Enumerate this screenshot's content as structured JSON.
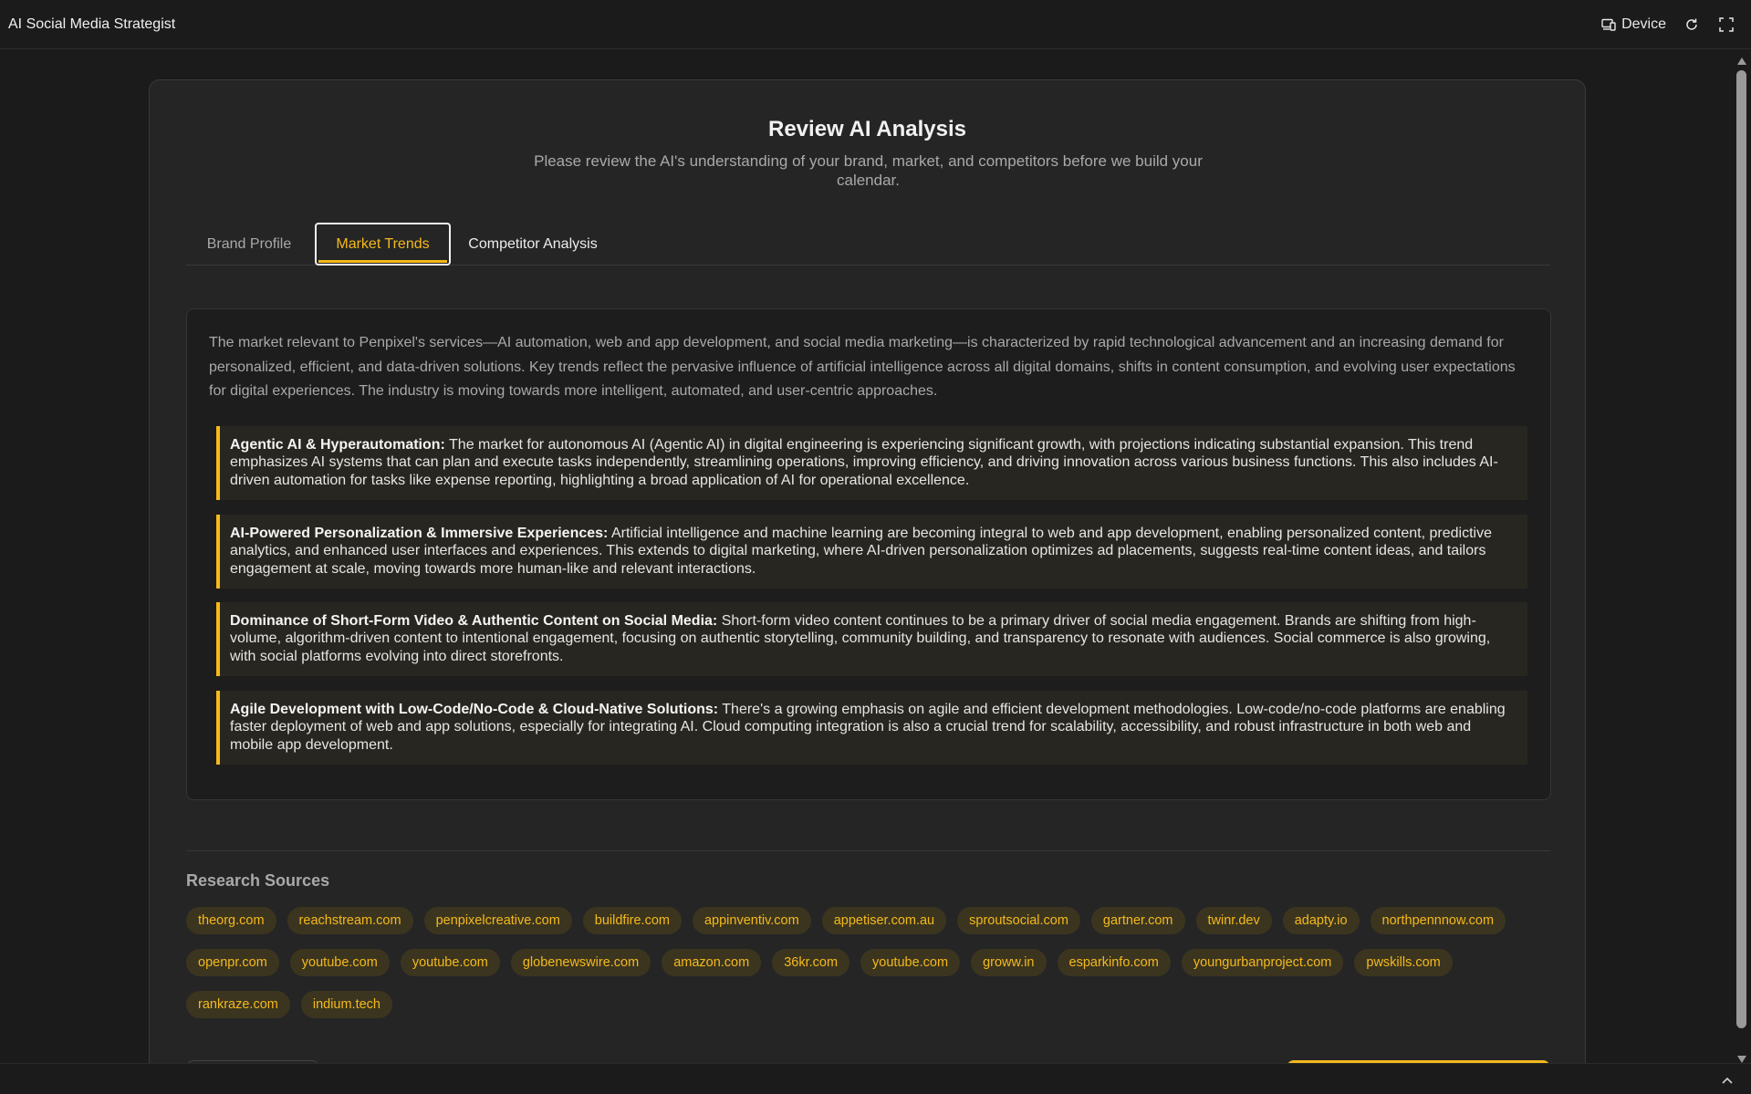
{
  "app": {
    "title": "AI Social Media Strategist",
    "device_label": "Device"
  },
  "header": {
    "title": "Review AI Analysis",
    "subtitle": "Please review the AI's understanding of your brand, market, and competitors before we build your calendar."
  },
  "tabs": [
    {
      "label": "Brand Profile",
      "active": false
    },
    {
      "label": "Market Trends",
      "active": true
    },
    {
      "label": "Competitor Analysis",
      "active": false
    }
  ],
  "market": {
    "intro": "The market relevant to Penpixel's services—AI automation, web and app development, and social media marketing—is characterized by rapid technological advancement and an increasing demand for personalized, efficient, and data-driven solutions. Key trends reflect the pervasive influence of artificial intelligence across all digital domains, shifts in content consumption, and evolving user expectations for digital experiences. The industry is moving towards more intelligent, automated, and user-centric approaches.",
    "trends": [
      {
        "title": "Agentic AI & Hyperautomation:",
        "text": " The market for autonomous AI (Agentic AI) in digital engineering is experiencing significant growth, with projections indicating substantial expansion. This trend emphasizes AI systems that can plan and execute tasks independently, streamlining operations, improving efficiency, and driving innovation across various business functions. This also includes AI-driven automation for tasks like expense reporting, highlighting a broad application of AI for operational excellence."
      },
      {
        "title": "AI-Powered Personalization & Immersive Experiences:",
        "text": " Artificial intelligence and machine learning are becoming integral to web and app development, enabling personalized content, predictive analytics, and enhanced user interfaces and experiences. This extends to digital marketing, where AI-driven personalization optimizes ad placements, suggests real-time content ideas, and tailors engagement at scale, moving towards more human-like and relevant interactions."
      },
      {
        "title": "Dominance of Short-Form Video & Authentic Content on Social Media:",
        "text": " Short-form video content continues to be a primary driver of social media engagement. Brands are shifting from high-volume, algorithm-driven content to intentional engagement, focusing on authentic storytelling, community building, and transparency to resonate with audiences. Social commerce is also growing, with social platforms evolving into direct storefronts."
      },
      {
        "title": "Agile Development with Low-Code/No-Code & Cloud-Native Solutions:",
        "text": " There's a growing emphasis on agile and efficient development methodologies. Low-code/no-code platforms are enabling faster deployment of web and app solutions, especially for integrating AI. Cloud computing integration is also a crucial trend for scalability, accessibility, and robust infrastructure in both web and mobile app development."
      }
    ]
  },
  "sources": {
    "title": "Research Sources",
    "items": [
      "theorg.com",
      "reachstream.com",
      "penpixelcreative.com",
      "buildfire.com",
      "appinventiv.com",
      "appetiser.com.au",
      "sproutsocial.com",
      "gartner.com",
      "twinr.dev",
      "adapty.io",
      "northpennnow.com",
      "openpr.com",
      "youtube.com",
      "youtube.com",
      "globenewswire.com",
      "amazon.com",
      "36kr.com",
      "youtube.com",
      "groww.in",
      "esparkinfo.com",
      "youngurbanproject.com",
      "pwskills.com",
      "rankraze.com",
      "indium.tech"
    ]
  },
  "colors": {
    "accent": "#f5b91b",
    "background": "#1b1b1b",
    "card": "#252525"
  }
}
